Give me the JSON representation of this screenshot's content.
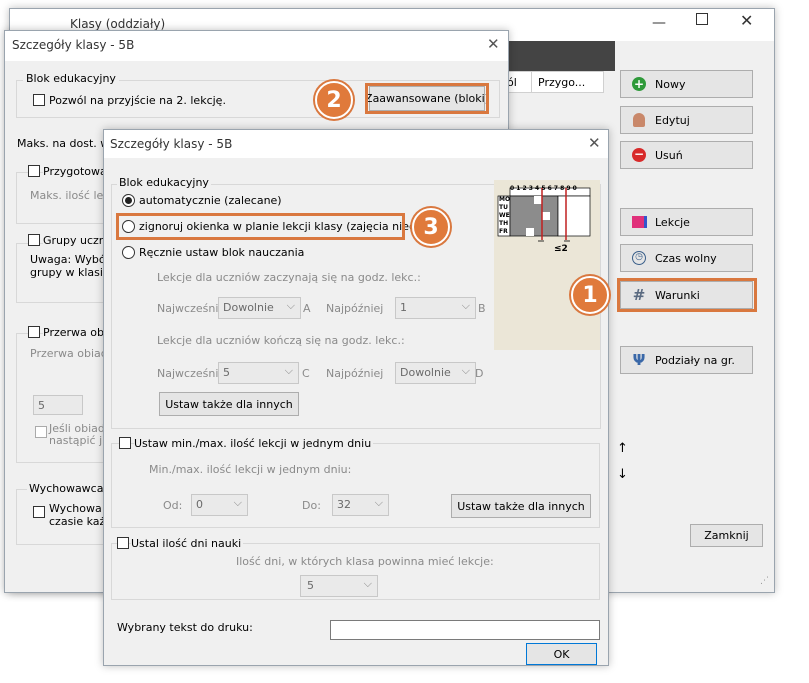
{
  "back_window": {
    "title": "Klasy (oddziały)",
    "columns": [
      "ól",
      "Przygo..."
    ],
    "buttons": {
      "new": "Nowy",
      "edit": "Edytuj",
      "delete": "Usuń",
      "lessons": "Lekcje",
      "free_time": "Czas wolny",
      "conditions": "Warunki",
      "divisions": "Podziały na gr.",
      "close": "Zamknij"
    },
    "arrows": {
      "up": "↑",
      "down": "↓"
    }
  },
  "mid_window": {
    "title": "Szczegóły klasy - 5B",
    "block_group": "Blok edukacyjny",
    "allow_second": "Pozwól na przyjście na 2. lekcję.",
    "advanced_button": "Zaawansowane (bloki)",
    "max_label": "Maks. na dost. w",
    "prep_label": "Przygotowa",
    "max_count_label": "Maks. ilość lekc",
    "groups_label": "Grupy ucznió",
    "note_line1": "Uwaga: Wybór",
    "note_line2": "grupy w klasie r",
    "lunch_label": "Przerwa obia",
    "lunch_sub": "Przerwa obiado",
    "lunch_value": "5",
    "lunch_note1": "Jeśli obiad j",
    "lunch_note2": "nastąpić ju",
    "tutor_group": "Wychowawca:",
    "tutor_line1": "Wychowa",
    "tutor_line2": "czasie każd"
  },
  "front_window": {
    "title": "Szczegóły klasy - 5B",
    "block_group": "Blok edukacyjny",
    "radio_auto": "automatycznie (zalecane)",
    "radio_ignore": "zignoruj okienka w planie lekcji klasy (zajęcia nieciągłe)",
    "radio_manual": "Ręcznie ustaw blok nauczania",
    "start_text": "Lekcje dla uczniów zaczynają się na godz. lekc.:",
    "earliest": "Najwcześnie",
    "latest": "Najpóźniej",
    "start_earliest_value": "Dowolnie",
    "start_latest_value": "1",
    "letter_a": "A",
    "letter_b": "B",
    "end_text": "Lekcje dla uczniów kończą się na godz. lekc.:",
    "end_earliest_value": "5",
    "end_latest_value": "Dowolnie",
    "letter_c": "C",
    "letter_d": "D",
    "set_for_others": "Ustaw także dla innych",
    "minmax_check": "Ustaw min./max. ilość lekcji w jednym dniu",
    "minmax_sub": "Min./max. ilość lekcji w jednym dniu:",
    "from_label": "Od:",
    "from_value": "0",
    "to_label": "Do:",
    "to_value": "32",
    "set_for_others2": "Ustaw także dla innych",
    "days_check": "Ustal ilość dni nauki",
    "days_sub": "Ilość dni, w których klasa powinna mieć lekcje:",
    "days_value": "5",
    "print_label": "Wybrany tekst do druku:",
    "print_value": "",
    "ok": "OK"
  },
  "mini_grid": {
    "header": "0 1 2 3 4 5 6 7 8 9 0",
    "days": [
      "MO",
      "TU",
      "WE",
      "TH",
      "FR"
    ],
    "gap_label": "≤2"
  },
  "badges": {
    "b1": "1",
    "b2": "2",
    "b3": "3"
  },
  "colors": {
    "accent": "#d9783f",
    "badge": "#e07a3b"
  }
}
